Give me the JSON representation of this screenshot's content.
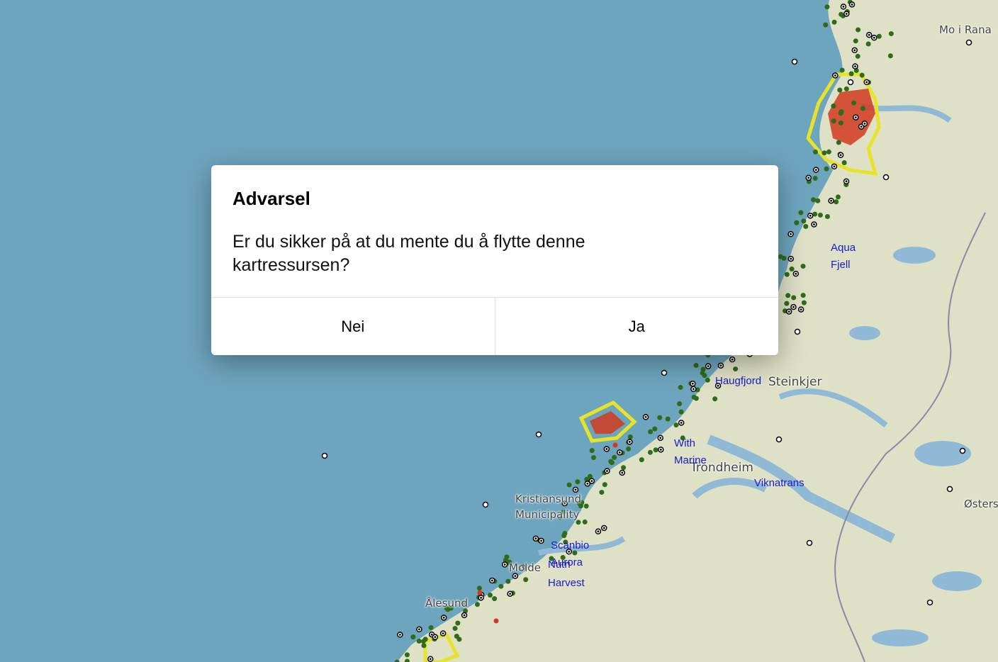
{
  "dialog": {
    "title": "Advarsel",
    "message": "Er du sikker på at du mente du å flytte denne kartressursen?",
    "cancel_label": "Nei",
    "confirm_label": "Ja"
  },
  "map": {
    "place_labels": [
      "Mo i Rana",
      "Steinkjer",
      "Trondheim",
      "Kristiansund Municipality",
      "Molde",
      "Ålesund",
      "Østersund"
    ],
    "marker_labels": [
      "Aqua Fjell",
      "Haugfjord",
      "With Marine",
      "Viknatrans",
      "Scanbio",
      "Aurora",
      "Nutri Harvest"
    ],
    "colors": {
      "sea": "#6ea5be",
      "land": "#dfe1c6",
      "marker_green": "#2e6b1a",
      "zone_red": "#d23a1e",
      "zone_yellow": "#e6e32a",
      "label_blue": "#1a1ac8"
    }
  }
}
